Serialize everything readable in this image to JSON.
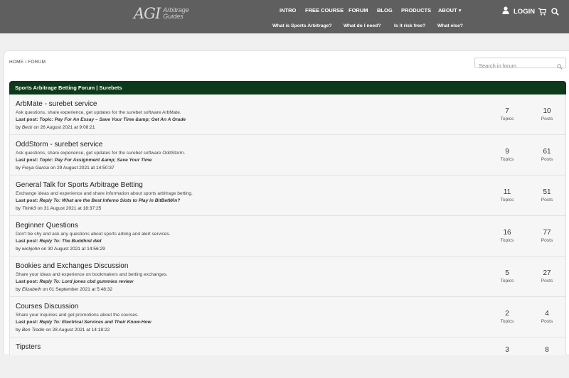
{
  "header": {
    "logo": {
      "mark": "AGI",
      "line1": "Arbitrage",
      "line2": "Guides"
    },
    "nav": [
      {
        "label": "INTRO"
      },
      {
        "label": "FREE COURSE"
      },
      {
        "label": "FORUM"
      },
      {
        "label": "BLOG"
      },
      {
        "label": "PRODUCTS"
      },
      {
        "label": "ABOUT ▾"
      }
    ],
    "subnav": [
      {
        "label": "What is Sports Arbitrage?"
      },
      {
        "label": "What do I need?"
      },
      {
        "label": "Is it risk free?"
      },
      {
        "label": "What else?"
      }
    ],
    "login_label": "LOGIN"
  },
  "breadcrumb": "HOME / FORUM",
  "search": {
    "placeholder": "Search in forum"
  },
  "forum_header": "Sports Arbitrage Betting Forum | Surebets",
  "labels": {
    "last_post": "Last post:",
    "by": "by",
    "on": "on",
    "topics": "Topics",
    "posts": "Posts"
  },
  "forums": [
    {
      "title": "ArbMate - surebet service",
      "description": "Ask questions, share experience, get updates for the surebet software ArbMate.",
      "last_post_title": "Topic: Pay For An Essay – Save Your Time &amp; Get An A Grade",
      "author": "Beck",
      "date": "26 August 2021 at 9:08:21",
      "topics": "7",
      "posts": "10"
    },
    {
      "title": "OddStorm - surebet service",
      "description": "Ask questions, share experience, get updates for the surebet software OddStorm.",
      "last_post_title": "Topic: Pay For Assignment &amp; Save Your Time",
      "author": "Freya Garcia",
      "date": "29 August 2021 at 14:50:37",
      "topics": "9",
      "posts": "61"
    },
    {
      "title": "General Talk for Sports Arbitrage Betting",
      "description": "Exchange ideas and experience and share information about sports arbitrage betting.",
      "last_post_title": "Reply To: What are the Best Inferno Slots to Play in BitBetWin?",
      "author": "Think3",
      "date": "31 August 2021 at 18:37:25",
      "topics": "11",
      "posts": "51"
    },
    {
      "title": "Beginner Questions",
      "description": "Don't be shy and ask any questions about sports arbing and alert services.",
      "last_post_title": "Reply To: The Buddhist diet",
      "author": "wickjohn",
      "date": "30 August 2021 at 14:56:29",
      "topics": "16",
      "posts": "77"
    },
    {
      "title": "Bookies and Exchanges Discussion",
      "description": "Share your ideas and experience on bookmakers and betting exchanges.",
      "last_post_title": "Reply To: Lord jones cbd gummies review",
      "author": "Elizabeth",
      "date": "01 September 2021 at 5:48:32",
      "topics": "5",
      "posts": "27"
    },
    {
      "title": "Courses Discussion",
      "description": "Share your inquiries and get promotions about the courses.",
      "last_post_title": "Reply To: Electrical Services and Their Know-How",
      "author": "Ben Tredin",
      "date": "28 August 2021 at 14:18:22",
      "topics": "2",
      "posts": "4"
    },
    {
      "title": "Tipsters",
      "description": "",
      "last_post_title": "",
      "author": "",
      "date": "",
      "topics": "3",
      "posts": "8"
    }
  ]
}
